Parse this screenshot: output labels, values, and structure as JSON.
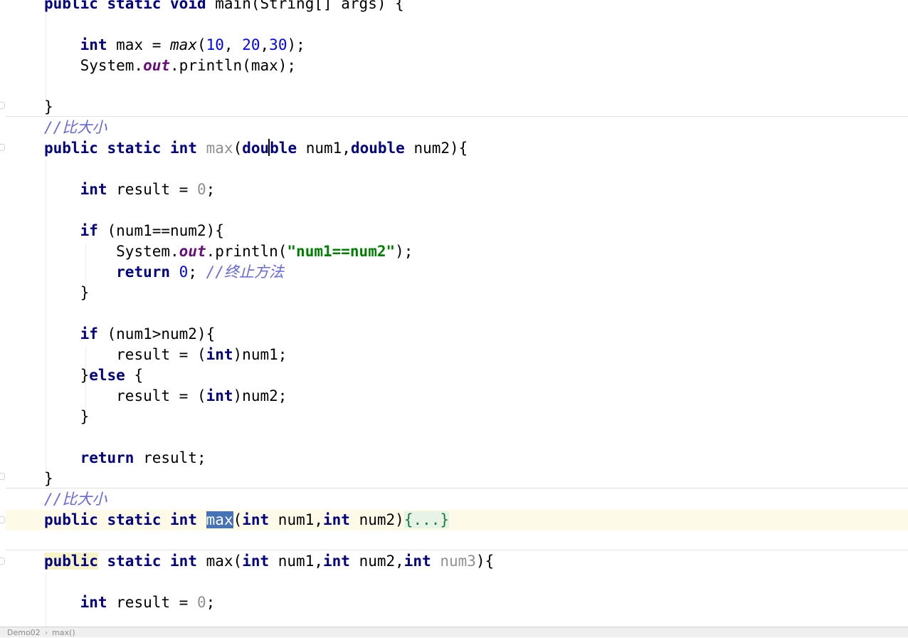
{
  "editor": {
    "lines": {
      "main_sig": {
        "kw1": "public",
        "kw2": "static",
        "kw3": "void",
        "rest": "main(String[] args) {"
      },
      "max_decl": {
        "kw": "int",
        "var": " max = ",
        "call": "max",
        "open": "(",
        "n1": "10",
        "c1": ", ",
        "n2": "20",
        "c2": ",",
        "n3": "30",
        "close": ");"
      },
      "println_max": {
        "cls": "System.",
        "fld": "out",
        "rest": ".println(max);"
      },
      "close_main": "}",
      "comment1": "//比大小",
      "double_sig": {
        "kw1": "public",
        "kw2": "static",
        "kw3": "int",
        "name": "max",
        "p1": "(",
        "t1a": "dou",
        "t1b": "ble",
        "a1": " num1,",
        "t2": "double",
        "a2": " num2){"
      },
      "result_decl": {
        "kw": "int",
        "rest": " result = ",
        "num": "0",
        "end": ";"
      },
      "if_eq": {
        "kw": "if",
        "rest": " (num1==num2){"
      },
      "println_eq": {
        "cls": "System.",
        "fld": "out",
        "mid": ".println(",
        "str": "\"num1==num2\"",
        "end": ");"
      },
      "return0": {
        "kw": "return",
        "num": "0",
        "semi": ";",
        "cmt": "//终止方法"
      },
      "close_if1": "}",
      "if_gt": {
        "kw": "if",
        "rest": " (num1>num2){"
      },
      "assign1": {
        "a": "result = (",
        "kw": "int",
        "b": ")num1;"
      },
      "else_line": {
        "a": "}",
        "kw": "else",
        "b": " {"
      },
      "assign2": {
        "a": "result = (",
        "kw": "int",
        "b": ")num2;"
      },
      "close_if2": "}",
      "return_result": {
        "kw": "return",
        "rest": " result;"
      },
      "close_method": "}",
      "comment2": "//比大小",
      "int_sig": {
        "kw1": "public",
        "kw2": "static",
        "kw3": "int",
        "name": "max",
        "p1": "(",
        "t1": "int",
        "a1": " num1,",
        "t2": "int",
        "a2": " num2)",
        "folded": "{...}"
      },
      "three_sig": {
        "kw1": "public",
        "kw2": "static",
        "kw3": "int",
        "name": " max(",
        "t1": "int",
        "a1": " num1,",
        "t2": "int",
        "a2": " num2,",
        "t3": "int",
        "a3": "num3",
        "end": "){"
      },
      "result_decl2": {
        "kw": "int",
        "rest": " result = ",
        "num": "0",
        "end": ";"
      }
    }
  },
  "statusbar": {
    "crumbs": [
      "Demo02",
      "max()"
    ],
    "separator": "›"
  }
}
